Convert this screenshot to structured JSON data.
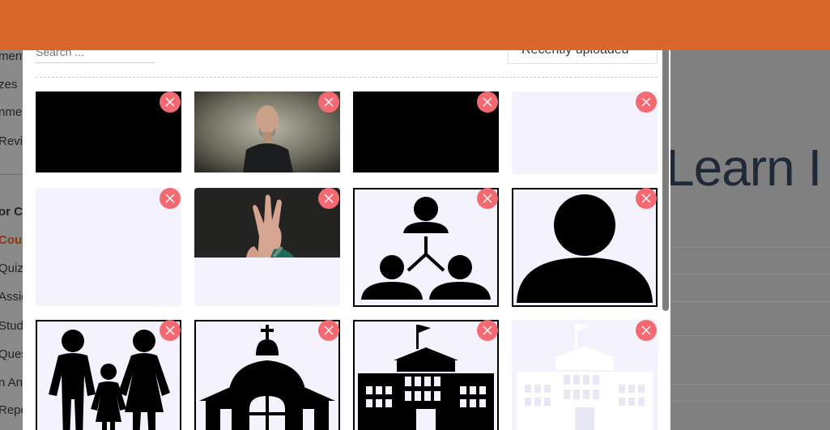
{
  "sidebar": {
    "items": [
      {
        "label": "ments"
      },
      {
        "label": "zes"
      },
      {
        "label": "nme"
      },
      {
        "label": "Revi"
      },
      {
        "label": "or Co"
      },
      {
        "label": "Cou"
      },
      {
        "label": "Quiz"
      },
      {
        "label": "Assig"
      },
      {
        "label": "Stud"
      },
      {
        "label": "Ques"
      },
      {
        "label": "n Ans"
      },
      {
        "label": "Repo"
      }
    ]
  },
  "background": {
    "heading": "Learn I"
  },
  "modal": {
    "search_placeholder": "Search ...",
    "sort_value": "Recently uploaded"
  },
  "media_tiles": [
    {
      "name": "black-video-1",
      "icon": "video-thumbnail"
    },
    {
      "name": "man-portrait",
      "icon": "photo-thumbnail"
    },
    {
      "name": "black-video-2",
      "icon": "video-thumbnail"
    },
    {
      "name": "blank-1",
      "icon": "blank-thumbnail"
    },
    {
      "name": "blank-2",
      "icon": "blank-thumbnail"
    },
    {
      "name": "praying-hands",
      "icon": "photo-thumbnail"
    },
    {
      "name": "network-people",
      "icon": "network-people-icon"
    },
    {
      "name": "person",
      "icon": "person-icon"
    },
    {
      "name": "family",
      "icon": "family-icon"
    },
    {
      "name": "church",
      "icon": "church-icon"
    },
    {
      "name": "school",
      "icon": "school-icon"
    },
    {
      "name": "school-white",
      "icon": "school-icon"
    }
  ],
  "colors": {
    "topbar": "#d9672b",
    "remove_button": "#f36a72",
    "tile_background": "#f3f2fd"
  }
}
